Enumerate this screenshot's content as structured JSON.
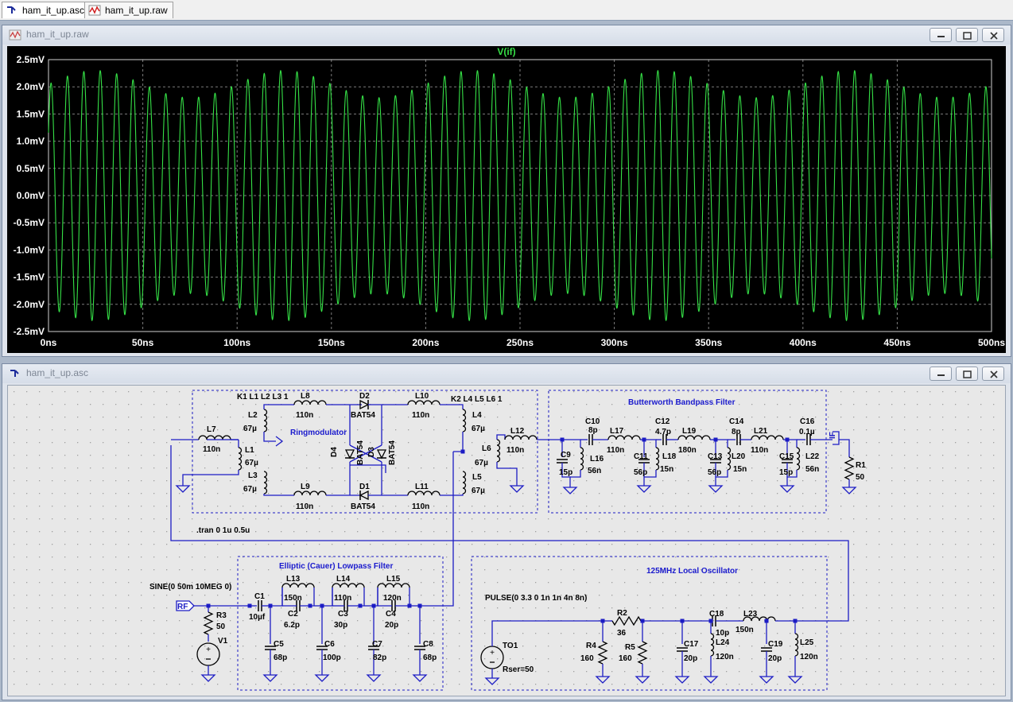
{
  "tabs": [
    {
      "label": "ham_it_up.asc",
      "icon": "schematic-icon"
    },
    {
      "label": "ham_it_up.raw",
      "icon": "waveform-icon"
    }
  ],
  "plot_window": {
    "title": "ham_it_up.raw",
    "buttons": [
      "minimize-button",
      "restore-button",
      "close-button"
    ]
  },
  "schematic_window": {
    "title": "ham_it_up.asc",
    "buttons": [
      "minimize-button",
      "restore-button",
      "close-button"
    ]
  },
  "colors": {
    "trace": "#35e046",
    "plot_bg": "#000000",
    "grid": "#7c7c7c",
    "axis_text": "#ffffff",
    "schematic_wire": "#1c1cc4",
    "schematic_text": "#000078",
    "group_title": "#1a1acd",
    "dot": "#9f9f9f",
    "component": "#000000"
  },
  "chart_data": {
    "type": "line",
    "title": "V(if)",
    "series": [
      {
        "name": "V(if)"
      }
    ],
    "x_range": [
      0,
      500
    ],
    "x_unit": "ns",
    "y_range": [
      -2.5,
      2.5
    ],
    "y_unit": "mV",
    "x_ticks": [
      "0ns",
      "50ns",
      "100ns",
      "150ns",
      "200ns",
      "250ns",
      "300ns",
      "350ns",
      "400ns",
      "450ns",
      "500ns"
    ],
    "y_ticks": [
      "2.5mV",
      "2.0mV",
      "1.5mV",
      "1.0mV",
      "0.5mV",
      "0.0mV",
      "-0.5mV",
      "-1.0mV",
      "-1.5mV",
      "-2.0mV",
      "-2.5mV"
    ],
    "signal": {
      "carrier_frequency_mhz": 115,
      "amplitude_mv": 2.05,
      "beat_frequency_mhz": 10,
      "beat_depth_mv": 0.25
    },
    "grid": true
  },
  "schematic": {
    "directives": {
      "coupling1": "K1 L1 L2 L3 1",
      "coupling2": "K2 L4 L5 L6 1",
      "tran": ".tran 0 1u 0.5u",
      "sine": "SINE(0 50m 10MEG 0)",
      "pulse": "PULSE(0 3.3 0 1n 1n 4n 8n)"
    },
    "groups": [
      {
        "title": "Ringmodulator"
      },
      {
        "title": "Butterworth Bandpass Filter"
      },
      {
        "title": "Elliptic (Cauer) Lowpass Filter"
      },
      {
        "title": "125MHz Local Oscillator"
      }
    ],
    "labels": [
      {
        "name": "L7",
        "value": "110n"
      },
      {
        "name": "L1",
        "value": "67µ"
      },
      {
        "name": "L2",
        "value": "67µ"
      },
      {
        "name": "L3",
        "value": "67µ"
      },
      {
        "name": "L8",
        "value": "110n"
      },
      {
        "name": "L9",
        "value": "110n"
      },
      {
        "name": "D2",
        "value": "BAT54"
      },
      {
        "name": "D1",
        "value": "BAT54"
      },
      {
        "name": "D4",
        "value": "BAT54"
      },
      {
        "name": "D3",
        "value": "BAT54"
      },
      {
        "name": "L10",
        "value": "110n"
      },
      {
        "name": "L11",
        "value": "110n"
      },
      {
        "name": "L4",
        "value": "67µ"
      },
      {
        "name": "L5",
        "value": "67µ"
      },
      {
        "name": "L6",
        "value": "67µ"
      },
      {
        "name": "L12",
        "value": "110n"
      },
      {
        "name": "C9",
        "value": "15p"
      },
      {
        "name": "L16",
        "value": "56n"
      },
      {
        "name": "C10",
        "value": "8p"
      },
      {
        "name": "L17",
        "value": "110n"
      },
      {
        "name": "C11",
        "value": "56p"
      },
      {
        "name": "L18",
        "value": "15n"
      },
      {
        "name": "C12",
        "value": "4.7p"
      },
      {
        "name": "L19",
        "value": "180n"
      },
      {
        "name": "C13",
        "value": "56p"
      },
      {
        "name": "L20",
        "value": "15n"
      },
      {
        "name": "C14",
        "value": "8p"
      },
      {
        "name": "L21",
        "value": "110n"
      },
      {
        "name": "C15",
        "value": "15p"
      },
      {
        "name": "L22",
        "value": "56n"
      },
      {
        "name": "C16",
        "value": "0.1µ"
      },
      {
        "name": "R1",
        "value": "50"
      },
      {
        "name": "C1",
        "value": "10µf"
      },
      {
        "name": "L13",
        "value": "150n"
      },
      {
        "name": "C2",
        "value": "6.2p"
      },
      {
        "name": "L14",
        "value": "110n"
      },
      {
        "name": "C3",
        "value": "30p"
      },
      {
        "name": "L15",
        "value": "120n"
      },
      {
        "name": "C4",
        "value": "20p"
      },
      {
        "name": "C5",
        "value": "68p"
      },
      {
        "name": "C6",
        "value": "100p"
      },
      {
        "name": "C7",
        "value": "82p"
      },
      {
        "name": "C8",
        "value": "68p"
      },
      {
        "name": "R3",
        "value": "50"
      },
      {
        "name": "V1",
        "value": ""
      },
      {
        "name": "R2",
        "value": "36"
      },
      {
        "name": "R4",
        "value": "160"
      },
      {
        "name": "R5",
        "value": "160"
      },
      {
        "name": "C17",
        "value": "20p"
      },
      {
        "name": "C18",
        "value": "10p"
      },
      {
        "name": "L24",
        "value": "120n"
      },
      {
        "name": "L23",
        "value": "150n"
      },
      {
        "name": "C19",
        "value": "20p"
      },
      {
        "name": "L25",
        "value": "120n"
      },
      {
        "name": "TO1",
        "value": "Rser=50"
      }
    ],
    "ports": [
      {
        "name": "RF"
      },
      {
        "name": "IF"
      }
    ]
  }
}
